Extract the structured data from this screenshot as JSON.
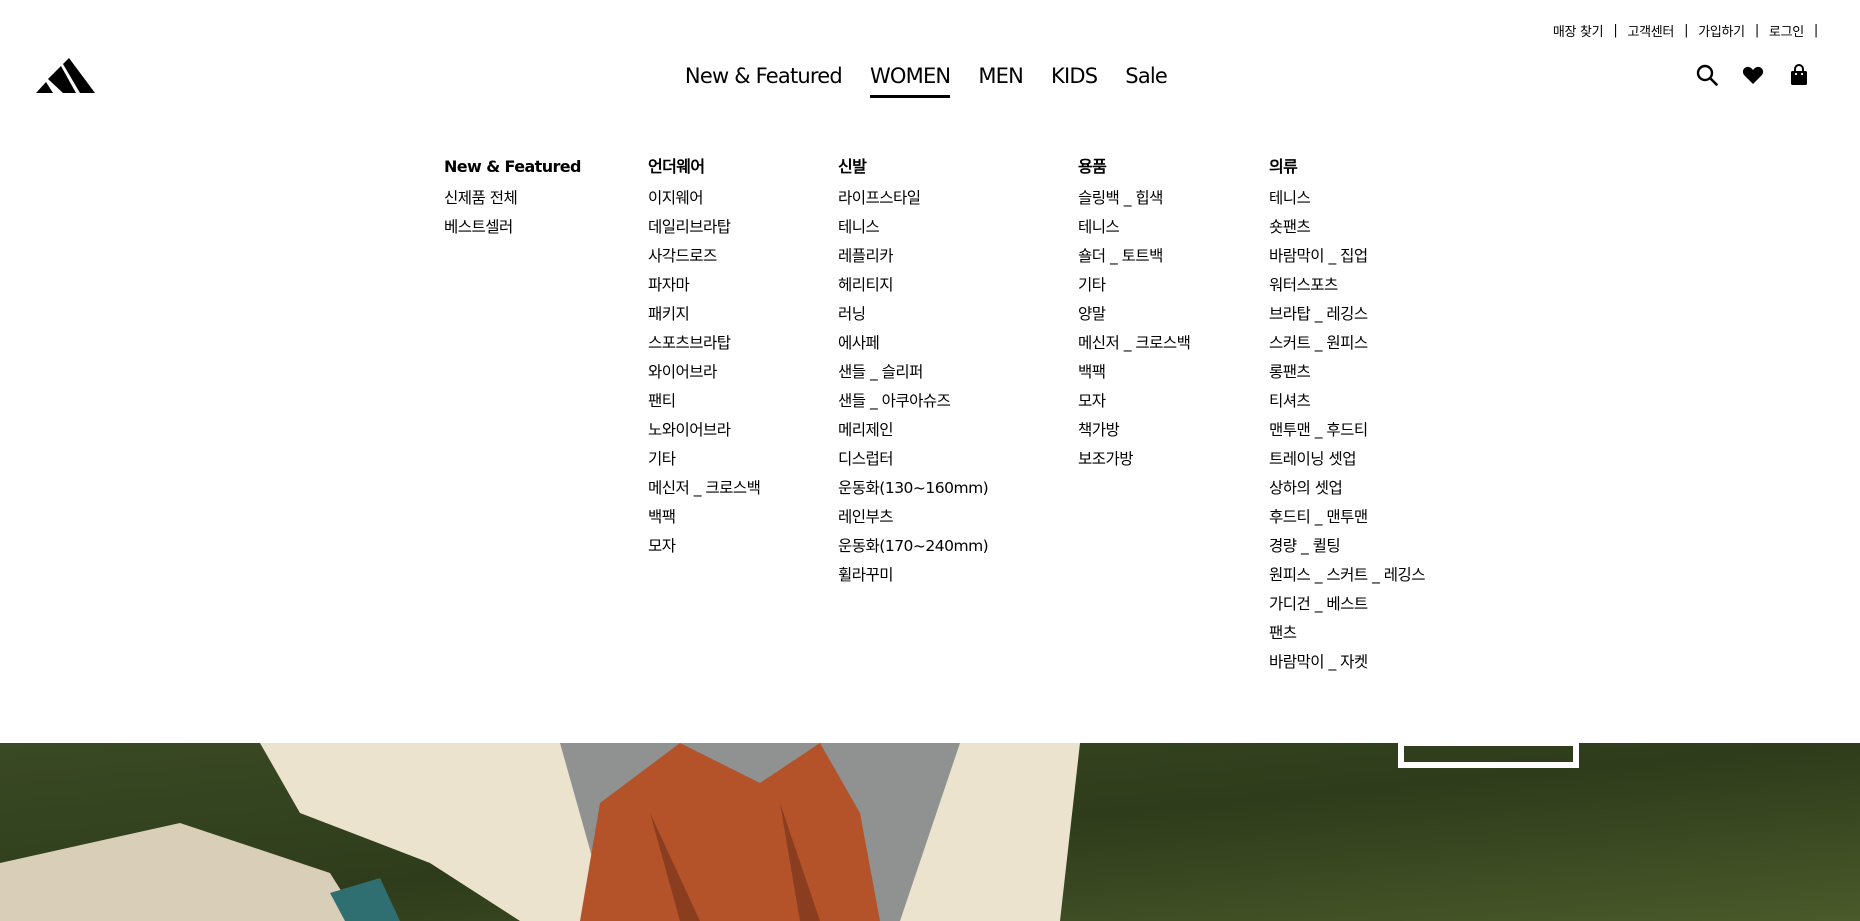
{
  "utility_nav": {
    "links": [
      "매장 찾기",
      "고객센터",
      "가입하기",
      "로그인"
    ],
    "separator": "|"
  },
  "main_nav": {
    "items": [
      "New & Featured",
      "WOMEN",
      "MEN",
      "KIDS",
      "Sale"
    ],
    "active": "WOMEN"
  },
  "header_icons": [
    "search-icon",
    "heart-icon",
    "shopping-bag-icon"
  ],
  "mega_menu": {
    "columns": [
      {
        "title": "New & Featured",
        "items": [
          "신제품 전체",
          "베스트셀러"
        ]
      },
      {
        "title": "언더웨어",
        "items": [
          "이지웨어",
          "데일리브라탑",
          "사각드로즈",
          "파자마",
          "패키지",
          "스포츠브라탑",
          "와이어브라",
          "팬티",
          "노와이어브라",
          "기타",
          "메신저 _ 크로스백",
          "백팩",
          "모자"
        ]
      },
      {
        "title": "신발",
        "items": [
          "라이프스타일",
          "테니스",
          "레플리카",
          "헤리티지",
          "러닝",
          "에사페",
          "샌들 _ 슬리퍼",
          "샌들 _ 아쿠아슈즈",
          "메리제인",
          "디스럽터",
          "운동화(130~160mm)",
          "레인부츠",
          "운동화(170~240mm)",
          "휠라꾸미"
        ]
      },
      {
        "title": "용품",
        "items": [
          "슬링백 _ 힙색",
          "테니스",
          "숄더 _ 토트백",
          "기타",
          "양말",
          "메신저 _ 크로스백",
          "백팩",
          "모자",
          "책가방",
          "보조가방"
        ]
      },
      {
        "title": "의류",
        "items": [
          "테니스",
          "숏팬츠",
          "바람막이 _ 집업",
          "워터스포츠",
          "브라탑 _ 레깅스",
          "스커트 _ 원피스",
          "롱팬츠",
          "티셔츠",
          "맨투맨 _ 후드티",
          "트레이닝 셋업",
          "상하의 셋업",
          "후드티 _ 맨투맨",
          "경량 _ 퀼팅",
          "원피스 _ 스커트 _ 레깅스",
          "가디건 _ 베스트",
          "팬츠",
          "바람막이 _ 자켓"
        ]
      }
    ]
  },
  "colors": {
    "text": "#000000",
    "background": "#ffffff",
    "hero_grass": "#3b4a22",
    "hero_hair": "#b4532a",
    "hero_shirt": "#ece3cf"
  }
}
